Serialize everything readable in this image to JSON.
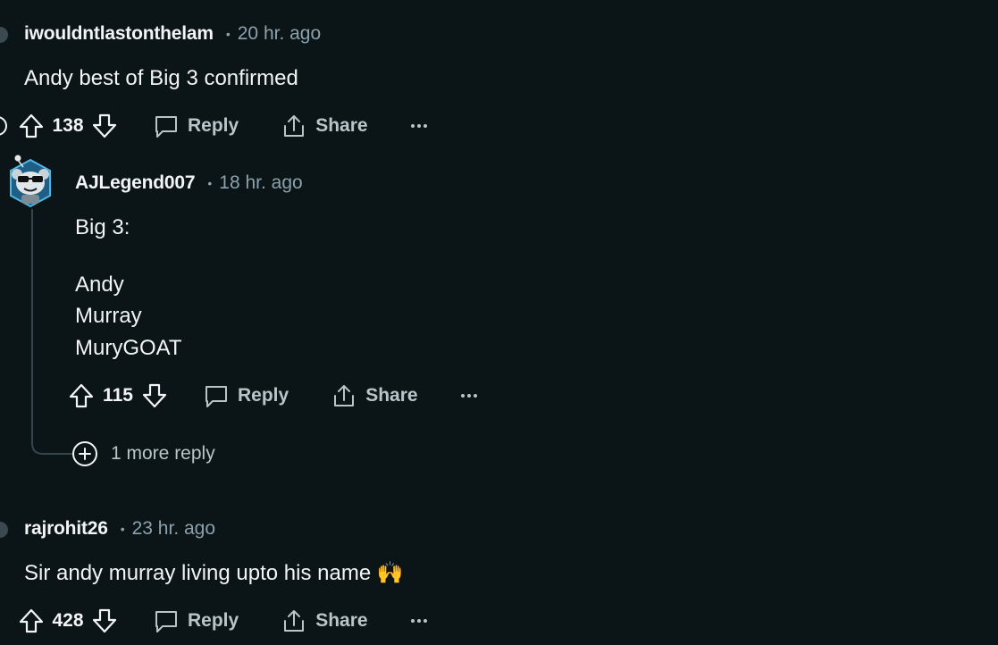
{
  "comments": [
    {
      "username": "iwouldntlastonthelam",
      "time": "20 hr. ago",
      "body": "Andy best of Big 3 confirmed",
      "votes": "138",
      "reply_label": "Reply",
      "share_label": "Share"
    },
    {
      "username": "AJLegend007",
      "time": "18 hr. ago",
      "body_lines": [
        "Big 3:",
        "Andy",
        "Murray",
        "MuryGOAT"
      ],
      "votes": "115",
      "reply_label": "Reply",
      "share_label": "Share",
      "more_replies": "1 more reply"
    },
    {
      "username": "rajrohit26",
      "time": "23 hr. ago",
      "body": "Sir andy murray living upto his name",
      "emoji": "🙌",
      "votes": "428",
      "reply_label": "Reply",
      "share_label": "Share"
    }
  ],
  "separator": "•",
  "colors": {
    "background": "#0b1416",
    "text": "#f2f4f5",
    "muted": "#8ba2ad",
    "action": "#b8c5c9",
    "thread_line": "#33464c",
    "avatar_accent": "#4fb6e8"
  },
  "icons": [
    "upvote-icon",
    "downvote-icon",
    "reply-bubble-icon",
    "share-icon",
    "more-dots-icon",
    "plus-circle-icon"
  ]
}
